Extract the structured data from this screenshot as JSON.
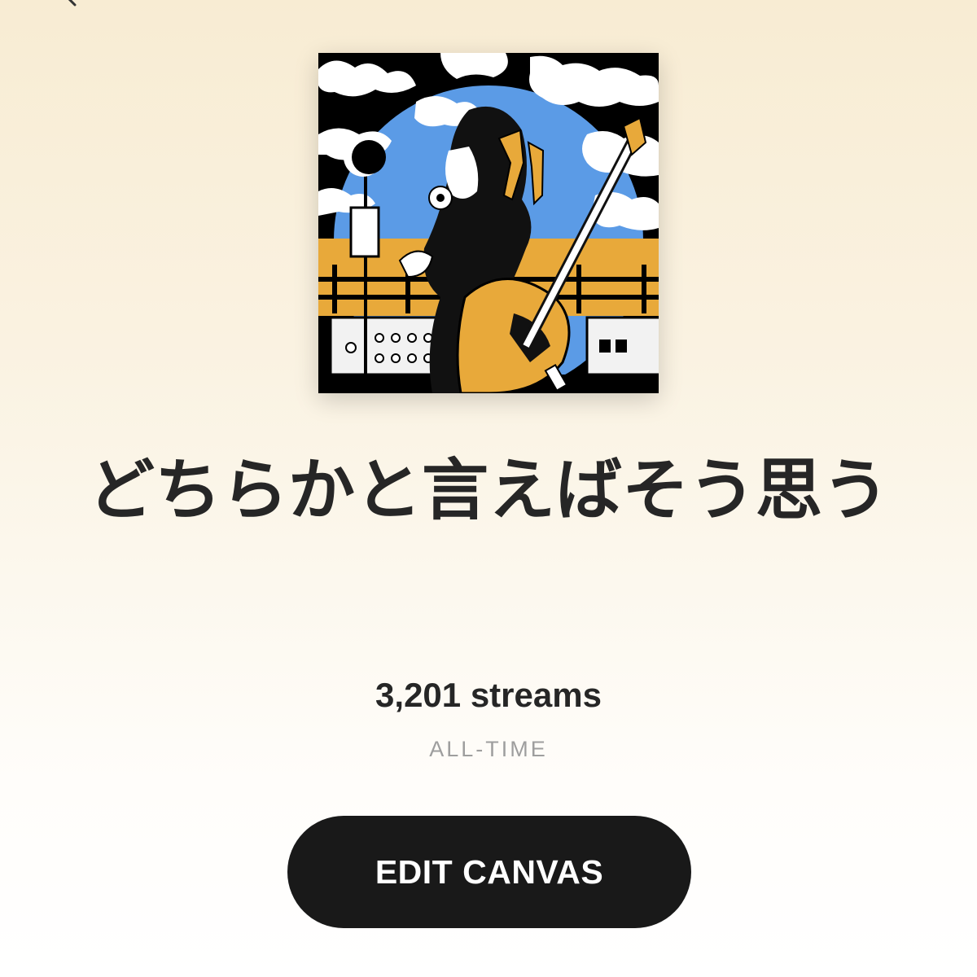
{
  "header": {
    "back_icon": "chevron-left-icon"
  },
  "track": {
    "title": "どちらかと言えばそう思う",
    "streams": "3,201 streams",
    "period": "ALL-TIME"
  },
  "actions": {
    "edit_canvas_label": "EDIT CANVAS"
  },
  "colors": {
    "background_top": "#f8ecd3",
    "background_bottom": "#ffffff",
    "button_bg": "#191919",
    "button_text": "#ffffff",
    "title_text": "#262626",
    "period_text": "#9e9e9e",
    "cover_sky": "#5b9be6",
    "cover_orange": "#e8a93a"
  }
}
